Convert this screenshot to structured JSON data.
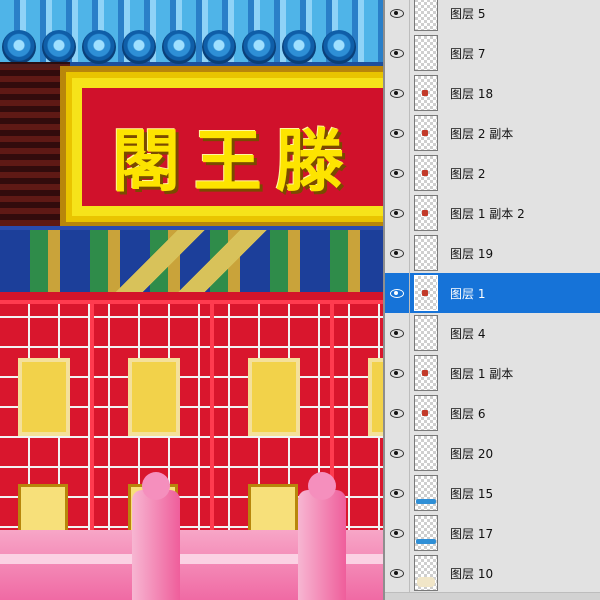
{
  "canvas": {
    "signboard_text": "閣王滕"
  },
  "layers_panel": {
    "layers": [
      {
        "name": "图层 5",
        "visible": true,
        "selected": false,
        "thumbnail": "transparent"
      },
      {
        "name": "图层 7",
        "visible": true,
        "selected": false,
        "thumbnail": "transparent"
      },
      {
        "name": "图层 18",
        "visible": true,
        "selected": false,
        "thumbnail": "small-mark"
      },
      {
        "name": "图层 2 副本",
        "visible": true,
        "selected": false,
        "thumbnail": "small-mark"
      },
      {
        "name": "图层 2",
        "visible": true,
        "selected": false,
        "thumbnail": "small-mark"
      },
      {
        "name": "图层 1 副本 2",
        "visible": true,
        "selected": false,
        "thumbnail": "small-mark"
      },
      {
        "name": "图层 19",
        "visible": true,
        "selected": false,
        "thumbnail": "transparent"
      },
      {
        "name": "图层 1",
        "visible": true,
        "selected": true,
        "thumbnail": "small-mark"
      },
      {
        "name": "图层 4",
        "visible": true,
        "selected": false,
        "thumbnail": "transparent"
      },
      {
        "name": "图层 1 副本",
        "visible": true,
        "selected": false,
        "thumbnail": "small-mark"
      },
      {
        "name": "图层 6",
        "visible": true,
        "selected": false,
        "thumbnail": "small-mark"
      },
      {
        "name": "图层 20",
        "visible": true,
        "selected": false,
        "thumbnail": "transparent"
      },
      {
        "name": "图层 15",
        "visible": true,
        "selected": false,
        "thumbnail": "wave"
      },
      {
        "name": "图层 17",
        "visible": true,
        "selected": false,
        "thumbnail": "wave"
      },
      {
        "name": "图层 10",
        "visible": true,
        "selected": false,
        "thumbnail": "cloud"
      }
    ],
    "selection_color": "#1673d8"
  }
}
